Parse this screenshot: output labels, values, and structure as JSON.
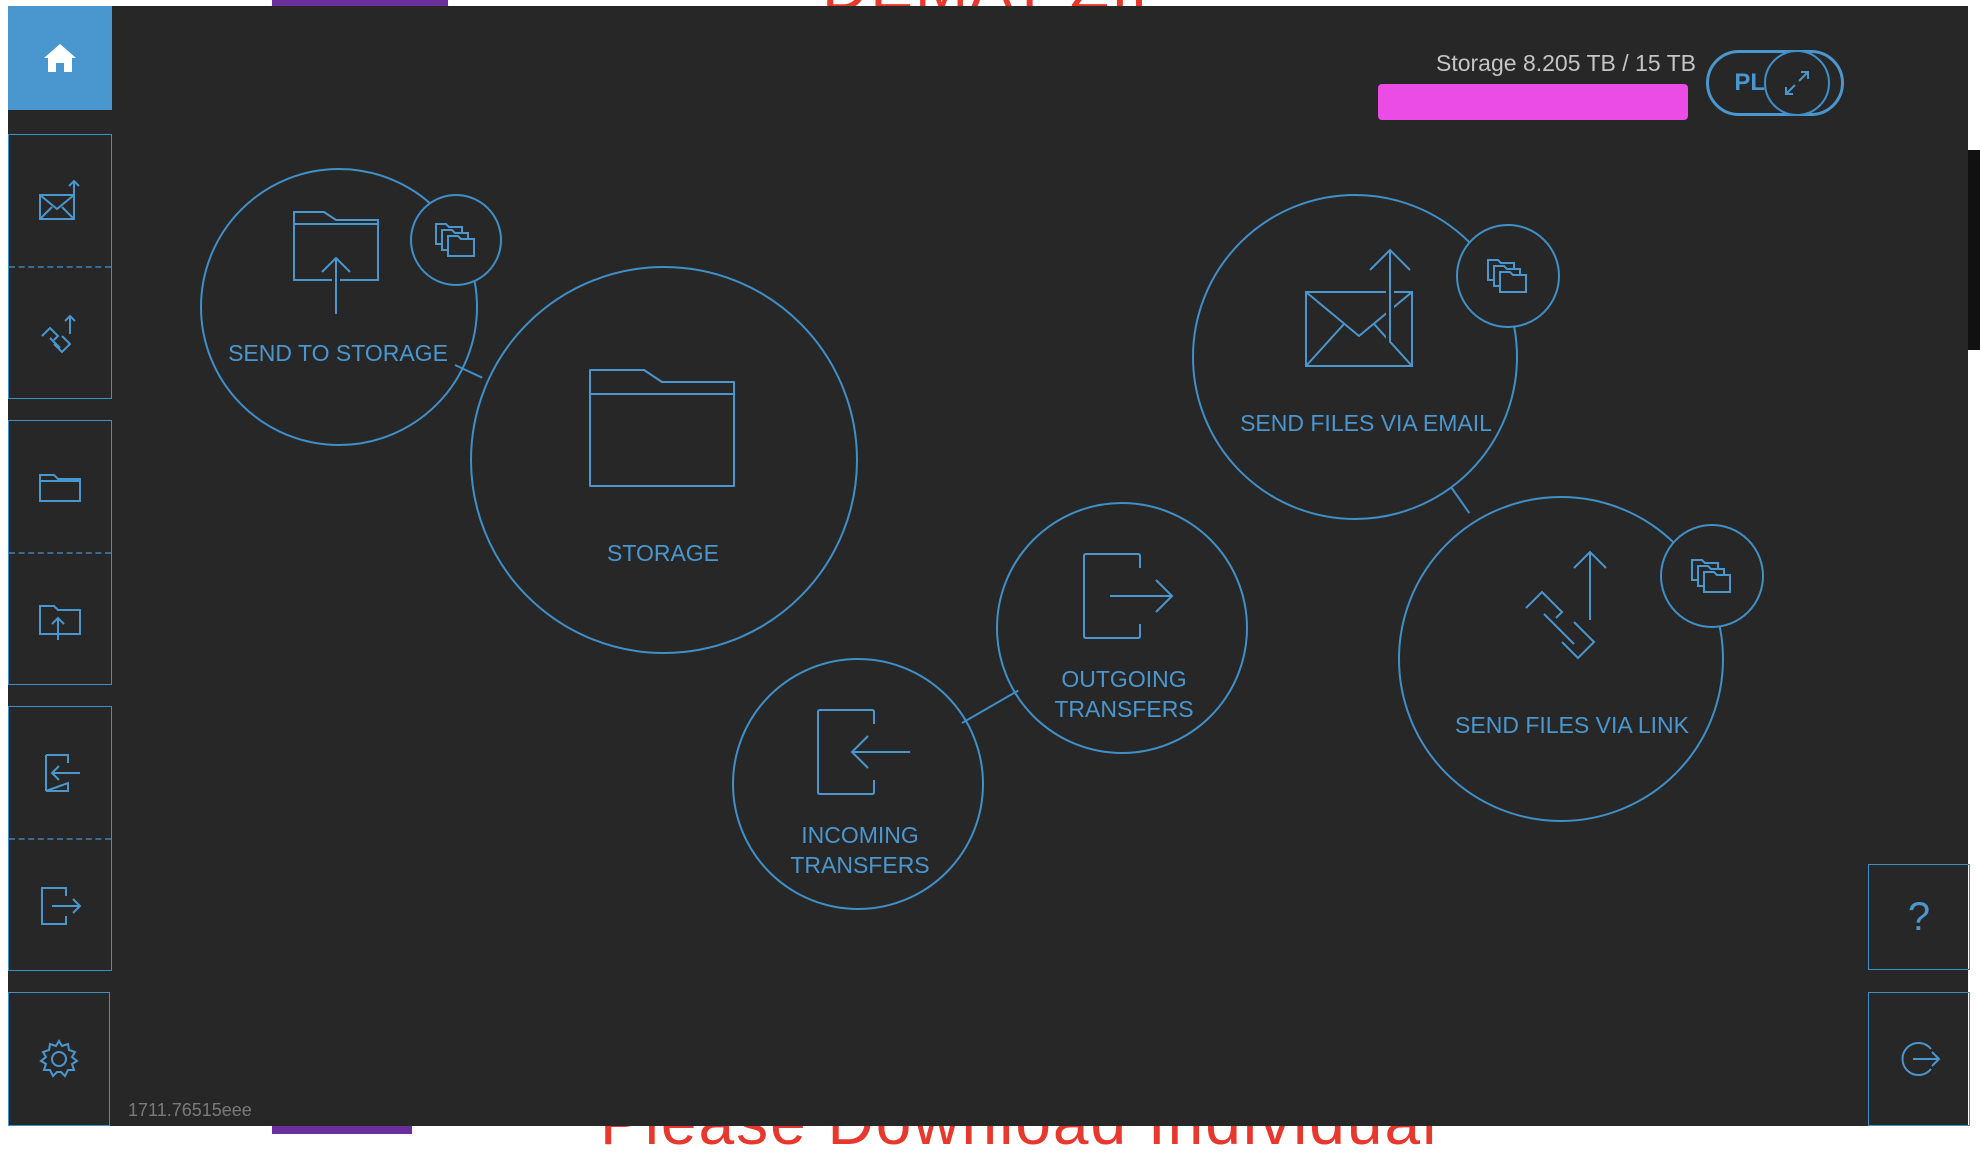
{
  "background_page": {
    "top_text": "DEMAT ZIP",
    "bottom_text": "Please Download Individual"
  },
  "header": {
    "storage_label": "Storage 8.205 TB / 15 TB",
    "plans_label": "PLANS"
  },
  "bubbles": {
    "send_to_storage": "SEND TO STORAGE",
    "storage": "STORAGE",
    "send_via_email": "SEND FILES VIA EMAIL",
    "send_via_link": "SEND FILES VIA LINK",
    "outgoing_line1": "OUTGOING",
    "outgoing_line2": "TRANSFERS",
    "incoming_line1": "INCOMING",
    "incoming_line2": "TRANSFERS"
  },
  "help": {
    "label": "?"
  },
  "footer": {
    "build_id": "1711.76515eee"
  },
  "colors": {
    "accent": "#4a97d0",
    "window_bg": "#272727",
    "redaction": "#ec4ce6"
  }
}
